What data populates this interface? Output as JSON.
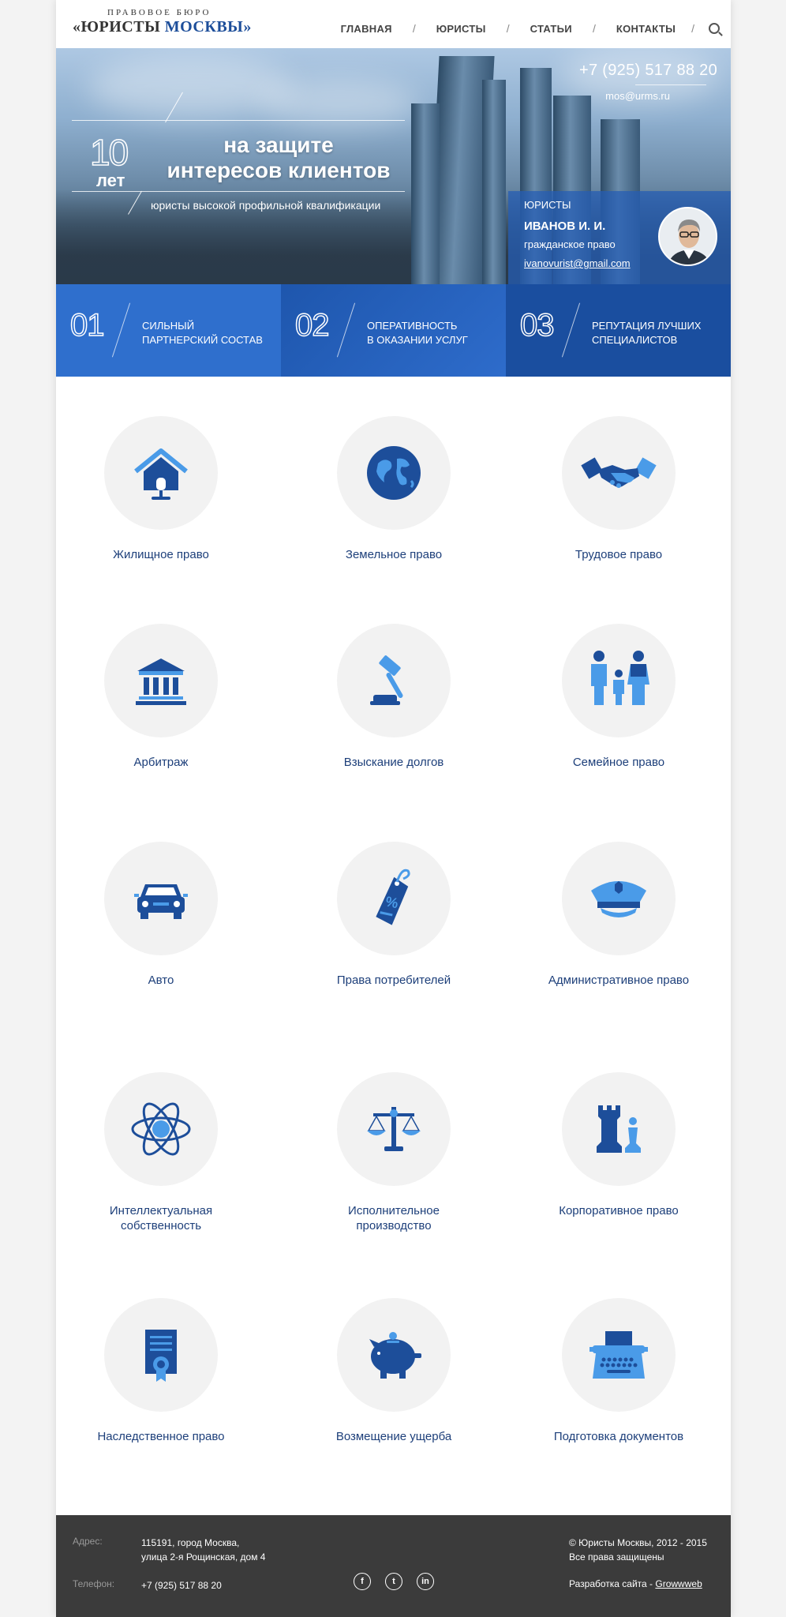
{
  "header": {
    "logo_top": "ПРАВОВОЕ БЮРО",
    "logo_left": "«ЮРИСТЫ",
    "logo_right": "МОСКВЫ»",
    "nav": [
      "ГЛАВНАЯ",
      "ЮРИСТЫ",
      "СТАТЬИ",
      "КОНТАКТЫ"
    ]
  },
  "hero": {
    "years_num": "10",
    "years_label": "лет",
    "title_line1": "на защите",
    "title_line2": "интересов клиентов",
    "subtitle": "юристы высокой профильной квалификации",
    "phone": "+7 (925) 517 88 20",
    "email": "mos@urms.ru"
  },
  "lawyer": {
    "label": "ЮРИСТЫ",
    "name": "ИВАНОВ И. И.",
    "specialty": "гражданское право",
    "email": "ivanovurist@gmail.com"
  },
  "features": [
    {
      "num": "01",
      "line1": "СИЛЬНЫЙ",
      "line2": "ПАРТНЕРСКИЙ СОСТАВ"
    },
    {
      "num": "02",
      "line1": "ОПЕРАТИВНОСТЬ",
      "line2": "В ОКАЗАНИИ УСЛУГ"
    },
    {
      "num": "03",
      "line1": "РЕПУТАЦИЯ ЛУЧШИХ",
      "line2": "СПЕЦИАЛИСТОВ"
    }
  ],
  "services": [
    {
      "label": "Жилищное право",
      "icon": "house-icon"
    },
    {
      "label": "Земельное право",
      "icon": "globe-icon"
    },
    {
      "label": "Трудовое право",
      "icon": "handshake-icon"
    },
    {
      "label": "Арбитраж",
      "icon": "courthouse-icon"
    },
    {
      "label": "Взыскание долгов",
      "icon": "gavel-icon"
    },
    {
      "label": "Семейное право",
      "icon": "family-icon"
    },
    {
      "label": "Авто",
      "icon": "car-icon"
    },
    {
      "label": "Права потребителей",
      "icon": "price-tag-icon"
    },
    {
      "label": "Административное право",
      "icon": "police-cap-icon"
    },
    {
      "label": "Интеллектуальная",
      "label2": "собственность",
      "icon": "atom-icon"
    },
    {
      "label": "Исполнительное",
      "label2": "производство",
      "icon": "scales-icon"
    },
    {
      "label": "Корпоративное право",
      "icon": "chess-icon"
    },
    {
      "label": "Наследственное право",
      "icon": "certificate-icon"
    },
    {
      "label": "Возмещение ущерба",
      "icon": "piggy-bank-icon"
    },
    {
      "label": "Подготовка документов",
      "icon": "typewriter-icon"
    }
  ],
  "footer": {
    "address_key": "Адрес:",
    "address_line1": "115191, город Москва,",
    "address_line2": "улица 2-я Рощинская, дом 4",
    "phone_key": "Телефон:",
    "phone": "+7 (925) 517 88 20",
    "copyright_line1": "© Юристы Москвы, 2012 - 2015",
    "copyright_line2": "Все права защищены",
    "dev_label": "Разработка сайта -",
    "dev_link": "Growwweb",
    "social": [
      "f",
      "t",
      "in"
    ]
  },
  "colors": {
    "primary": "#1d4e9a",
    "accent": "#4a9be8",
    "footer": "#3b3b3b"
  }
}
